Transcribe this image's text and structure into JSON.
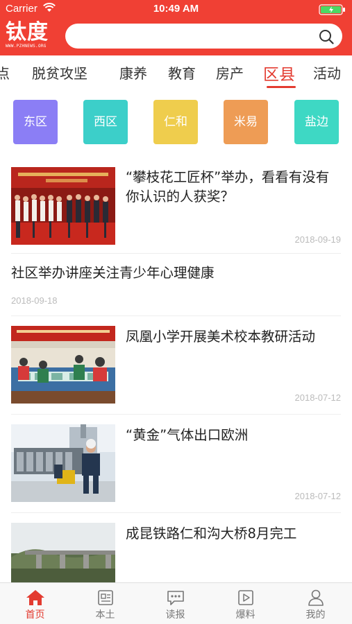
{
  "status": {
    "carrier": "Carrier",
    "time": "10:49 AM"
  },
  "header": {
    "logo_text": "钛度",
    "logo_url": "WWW.PZHNEWS.ORG",
    "search_placeholder": ""
  },
  "channel_tabs": [
    "点",
    "脱贫攻坚",
    "康养",
    "教育",
    "房产",
    "区县",
    "活动"
  ],
  "active_tab": "区县",
  "districts": [
    {
      "label": "东区",
      "color": "#8b7ef5"
    },
    {
      "label": "西区",
      "color": "#3ccfc9"
    },
    {
      "label": "仁和",
      "color": "#efcd4d"
    },
    {
      "label": "米易",
      "color": "#ee9c55"
    },
    {
      "label": "盐边",
      "color": "#3ed8c4"
    }
  ],
  "news": [
    {
      "title": "“攀枝花工匠杯”举办，看看有没有你认识的人获奖？",
      "date": "2018-09-19",
      "has_image": true
    },
    {
      "title": "社区举办讲座关注青少年心理健康",
      "date": "2018-09-18",
      "has_image": false
    },
    {
      "title": "凤凰小学开展美术校本教研活动",
      "date": "2018-07-12",
      "has_image": true
    },
    {
      "title": "“黄金”气体出口欧洲",
      "date": "2018-07-12",
      "has_image": true
    },
    {
      "title": "成昆铁路仁和沟大桥8月完工",
      "date": "",
      "has_image": true
    }
  ],
  "bottom_tabs": [
    {
      "label": "首页",
      "icon": "home-icon",
      "active": true
    },
    {
      "label": "本土",
      "icon": "local-news-icon",
      "active": false
    },
    {
      "label": "读报",
      "icon": "chat-bubble-icon",
      "active": false
    },
    {
      "label": "爆料",
      "icon": "video-play-icon",
      "active": false
    },
    {
      "label": "我的",
      "icon": "user-icon",
      "active": false
    }
  ],
  "colors": {
    "brand_red": "#f04034",
    "accent_red": "#e33b30"
  }
}
